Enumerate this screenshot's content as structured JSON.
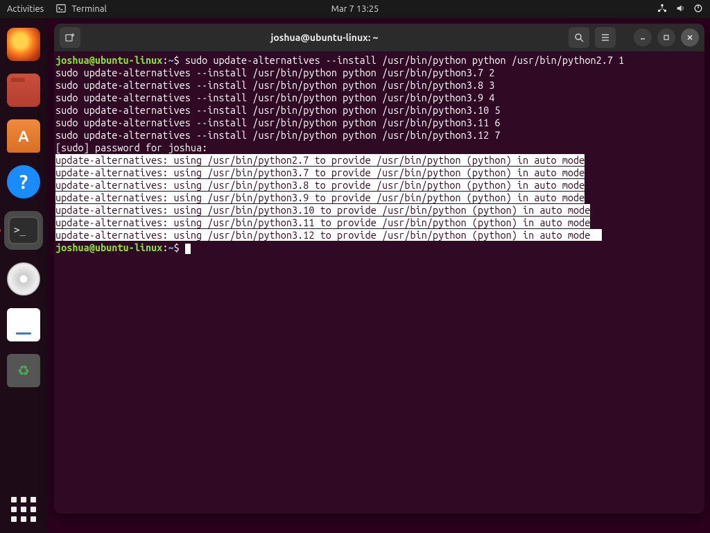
{
  "topbar": {
    "activities": "Activities",
    "app_name": "Terminal",
    "datetime": "Mar 7  13:25"
  },
  "dock": {
    "items": [
      "firefox",
      "files",
      "software",
      "help",
      "terminal",
      "disc",
      "text-editor",
      "trash"
    ]
  },
  "window": {
    "title": "joshua@ubuntu-linux: ~"
  },
  "prompt": {
    "user": "joshua",
    "at": "@",
    "host": "ubuntu-linux",
    "path": "~",
    "symbol": "$"
  },
  "terminal": {
    "cmd_first": "sudo update-alternatives --install /usr/bin/python python /usr/bin/python2.7 1",
    "cmds": [
      "sudo update-alternatives --install /usr/bin/python python /usr/bin/python3.7 2",
      "sudo update-alternatives --install /usr/bin/python python /usr/bin/python3.8 3",
      "sudo update-alternatives --install /usr/bin/python python /usr/bin/python3.9 4",
      "sudo update-alternatives --install /usr/bin/python python /usr/bin/python3.10 5",
      "sudo update-alternatives --install /usr/bin/python python /usr/bin/python3.11 6",
      "sudo update-alternatives --install /usr/bin/python python /usr/bin/python3.12 7"
    ],
    "sudo_prompt": "[sudo] password for joshua:",
    "outputs": [
      "update-alternatives: using /usr/bin/python2.7 to provide /usr/bin/python (python) in auto mode",
      "update-alternatives: using /usr/bin/python3.7 to provide /usr/bin/python (python) in auto mode",
      "update-alternatives: using /usr/bin/python3.8 to provide /usr/bin/python (python) in auto mode",
      "update-alternatives: using /usr/bin/python3.9 to provide /usr/bin/python (python) in auto mode",
      "update-alternatives: using /usr/bin/python3.10 to provide /usr/bin/python (python) in auto mode",
      "update-alternatives: using /usr/bin/python3.11 to provide /usr/bin/python (python) in auto mode",
      "update-alternatives: using /usr/bin/python3.12 to provide /usr/bin/python (python) in auto mode"
    ],
    "pad_last": "  "
  }
}
